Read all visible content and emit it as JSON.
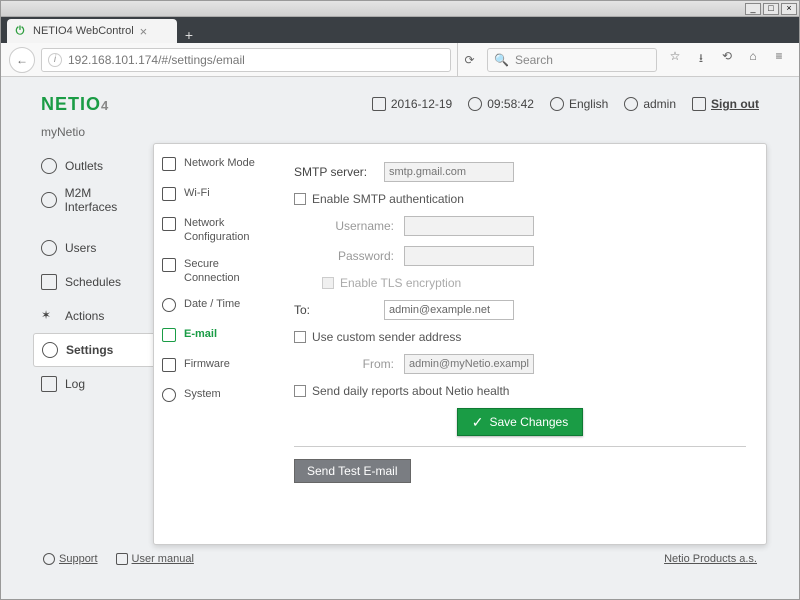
{
  "os": {
    "min": "_",
    "max": "□",
    "close": "×"
  },
  "browser": {
    "tab_title": "NETIO4 WebControl",
    "newtab": "+",
    "back": "←",
    "url": "192.168.101.174/#/settings/email",
    "refresh": "⟳",
    "search_icon": "🔍",
    "search_placeholder": "Search",
    "star": "☆",
    "dl": "⭳",
    "hist": "⟲",
    "home": "⌂",
    "menu": "≡"
  },
  "header": {
    "logo": "NETIO",
    "logo_sup": "4",
    "subtitle": "myNetio",
    "date": "2016-12-19",
    "time": "09:58:42",
    "lang": "English",
    "user": "admin",
    "signout": "Sign out"
  },
  "nav1": {
    "items": [
      {
        "label": "Outlets"
      },
      {
        "label": "M2M Interfaces"
      },
      {
        "label": "Users"
      },
      {
        "label": "Schedules"
      },
      {
        "label": "Actions"
      },
      {
        "label": "Settings"
      },
      {
        "label": "Log"
      }
    ]
  },
  "nav2": {
    "items": [
      {
        "label": "Network Mode"
      },
      {
        "label": "Wi-Fi"
      },
      {
        "label": "Network Configuration"
      },
      {
        "label": "Secure Connection"
      },
      {
        "label": "Date / Time"
      },
      {
        "label": "E-mail"
      },
      {
        "label": "Firmware"
      },
      {
        "label": "System"
      }
    ]
  },
  "form": {
    "smtp_label": "SMTP server:",
    "smtp_placeholder": "smtp.gmail.com",
    "enable_auth": "Enable SMTP authentication",
    "username_label": "Username:",
    "password_label": "Password:",
    "enable_tls": "Enable TLS encryption",
    "to_label": "To:",
    "to_value": "admin@example.net",
    "custom_sender": "Use custom sender address",
    "from_label": "From:",
    "from_placeholder": "admin@myNetio.example",
    "daily_reports": "Send daily reports about Netio health",
    "save": "Save Changes",
    "send_test": "Send Test E-mail"
  },
  "footer": {
    "support": "Support",
    "manual": "User manual",
    "company": "Netio Products a.s."
  }
}
